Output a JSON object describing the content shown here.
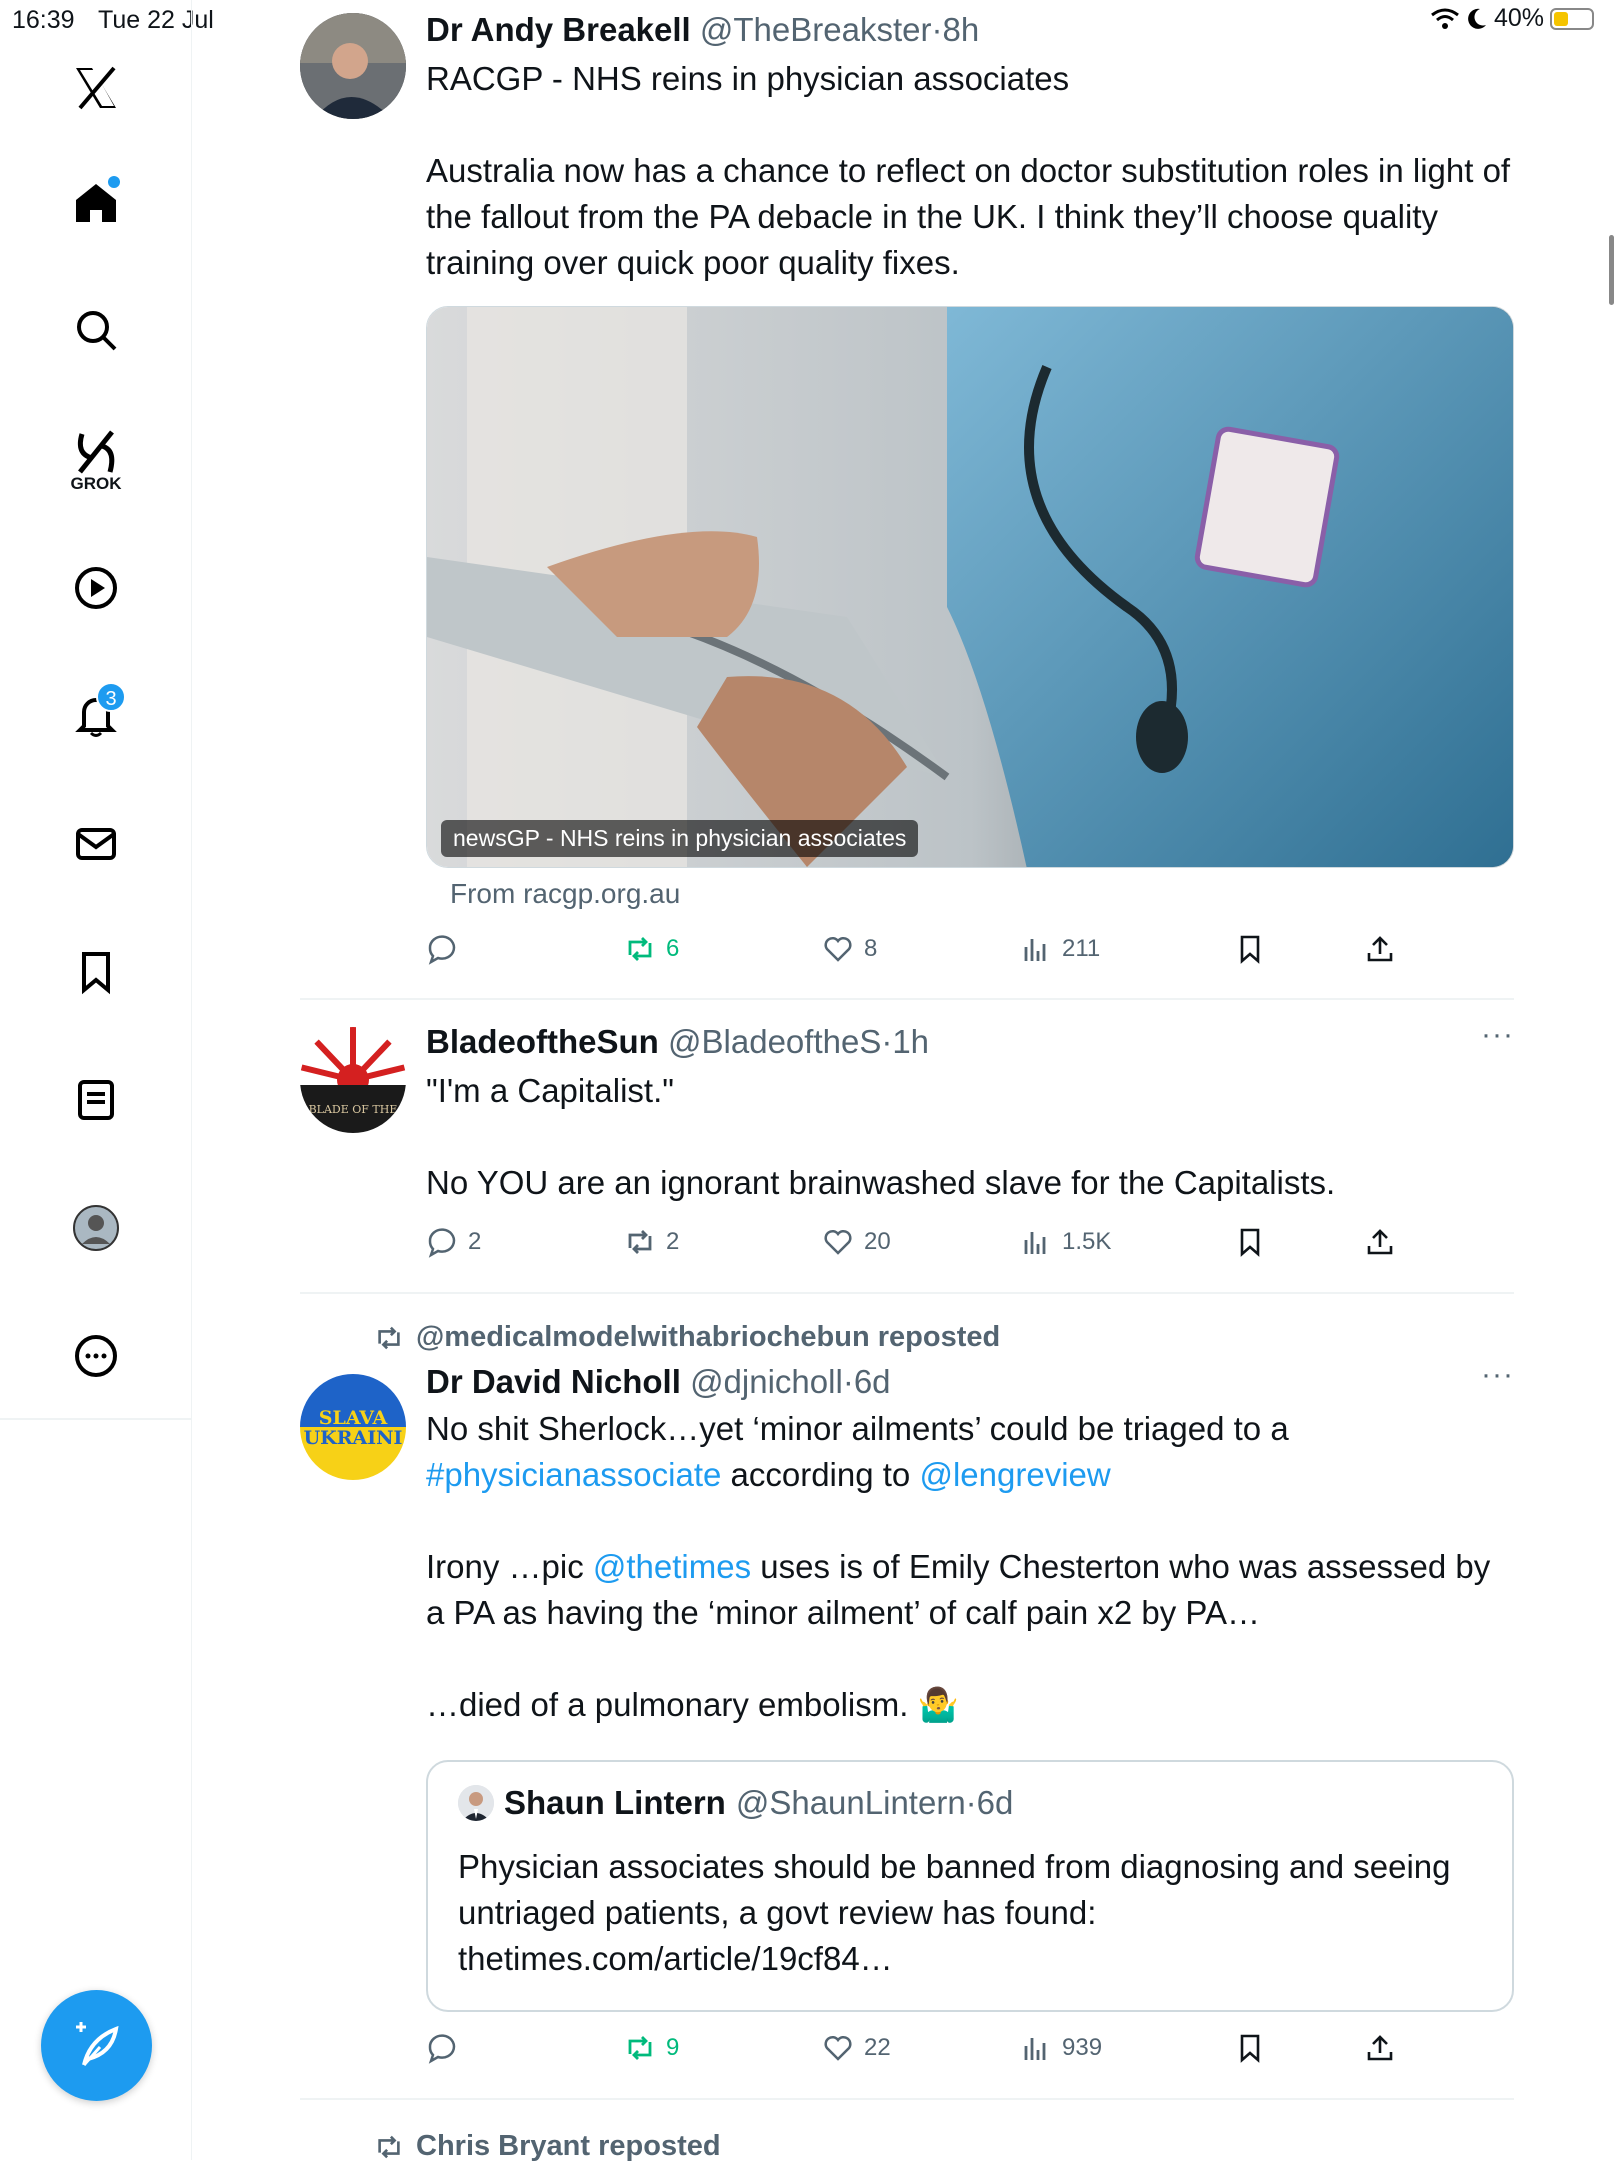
{
  "status_bar": {
    "time": "16:39",
    "date": "Tue 22 Jul",
    "battery": "40%",
    "battery_level": 0.4
  },
  "sidebar": {
    "grok_label": "GROK",
    "notifications_count": "3"
  },
  "posts": [
    {
      "name": "Dr Andy Breakell",
      "handle": "@TheBreakster",
      "time": "8h",
      "text": [
        "RACGP - NHS reins in physician associates",
        "",
        "Australia now has a chance to reflect on doctor substitution roles in light of the fallout from the PA debacle in the UK. I think they’ll choose quality training over quick poor quality fixes."
      ],
      "media_caption": "newsGP - NHS reins in physician associates",
      "from": "From racgp.org.au",
      "replies": "",
      "reposts": "6",
      "likes": "8",
      "views": "211"
    },
    {
      "name": "BladeoftheSun",
      "handle": "@BladeoftheS",
      "time": "1h",
      "text": [
        "\"I'm a Capitalist.\"",
        "",
        "No YOU are an ignorant brainwashed slave for the Capitalists."
      ],
      "avatar_text": "BLADE OF THE",
      "replies": "2",
      "reposts": "2",
      "likes": "20",
      "views": "1.5K"
    },
    {
      "reposted_by": "@medicalmodelwithabriochebun reposted",
      "name": "Dr David Nicholl",
      "handle": "@djnicholl",
      "time": "6d",
      "avatar_text_1": "SLAVA",
      "avatar_text_2": "UKRAINI",
      "line1": "No shit Sherlock…yet ‘minor ailments’ could be triaged to a",
      "hashtag": "#physicianassociate",
      "mid": " according to ",
      "mention1": "@lengreview",
      "irony_pre": "Irony …pic ",
      "mention2": "@thetimes",
      "irony_post": " uses is of Emily Chesterton who was assessed by a PA as having the ‘minor ailment’ of calf pain x2 by PA…",
      "last": "…died of a pulmonary embolism. 🤷‍♂️",
      "quote": {
        "name": "Shaun Lintern",
        "handle": "@ShaunLintern",
        "time": "6d",
        "text": "Physician associates should be banned from diagnosing and seeing untriaged patients, a govt review has found: thetimes.com/article/19cf84…"
      },
      "replies": "",
      "reposts": "9",
      "likes": "22",
      "views": "939"
    },
    {
      "reposted_by": "Chris Bryant reposted"
    }
  ],
  "icons": {
    "reply": "reply-icon",
    "repost": "repost-icon",
    "like": "heart-icon",
    "views": "views-icon",
    "bookmark": "bookmark-icon",
    "share": "share-icon"
  }
}
